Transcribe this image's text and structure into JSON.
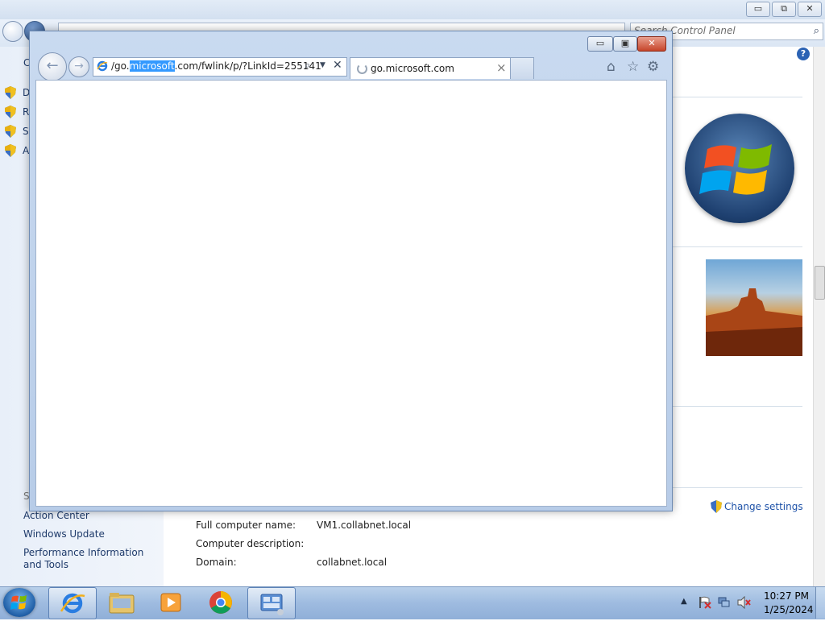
{
  "control_panel": {
    "search_placeholder": "Search Control Panel",
    "title_buttons": {
      "minimize": "▭",
      "maximize": "⧉",
      "close": "✕"
    },
    "left_pane": {
      "task_letters": [
        "D",
        "R",
        "S",
        "A"
      ],
      "top_letter": "C",
      "see_also_letter": "S",
      "links": [
        "Action Center",
        "Windows Update",
        "Performance Information and Tools"
      ]
    },
    "properties": [
      {
        "label": "Full computer name:",
        "value": "VM1.collabnet.local"
      },
      {
        "label": "Computer description:",
        "value": ""
      },
      {
        "label": "Domain:",
        "value": "collabnet.local"
      }
    ],
    "change_settings": "Change settings",
    "help_icon": "?"
  },
  "ie": {
    "address_prefix": "/go.",
    "address_selected": "microsoft",
    "address_suffix": ".com/fwlink/p/?LinkId=255141",
    "tab_title": "go.microsoft.com",
    "tab_close": "×",
    "title_buttons": {
      "minimize": "▭",
      "maximize": "▣",
      "close": "✕"
    }
  },
  "taskbar": {
    "time": "10:27 PM",
    "date": "1/25/2024"
  }
}
